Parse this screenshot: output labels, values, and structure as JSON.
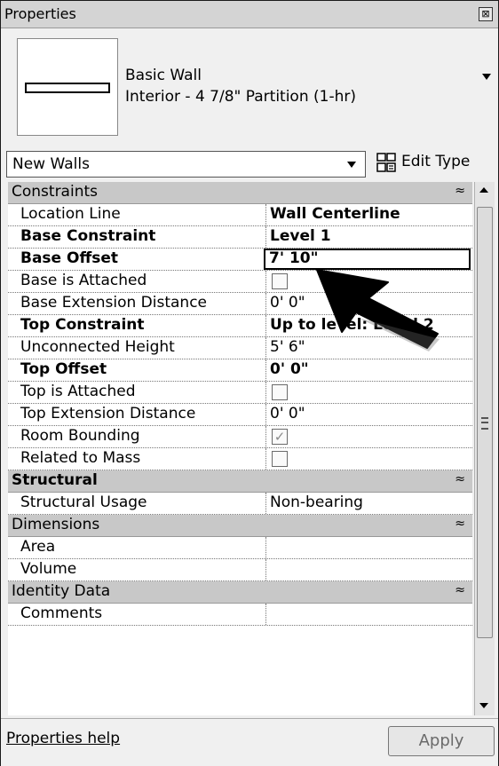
{
  "window": {
    "title": "Properties",
    "close_glyph": "⊠"
  },
  "type_selector": {
    "family": "Basic Wall",
    "type": "Interior - 4 7/8\" Partition (1-hr)"
  },
  "filter": {
    "value": "New Walls"
  },
  "edit_type": {
    "label": "Edit Type"
  },
  "groups": {
    "constraints": "Constraints",
    "structural": "Structural",
    "dimensions": "Dimensions",
    "identity": "Identity Data"
  },
  "chevron": "≈",
  "rows": {
    "location_line": {
      "name": "Location Line",
      "value": "Wall Centerline"
    },
    "base_constraint": {
      "name": "Base Constraint",
      "value": "Level 1"
    },
    "base_offset": {
      "name": "Base Offset",
      "value": "7' 10\""
    },
    "base_attached": {
      "name": "Base is Attached",
      "checked": false
    },
    "base_extension": {
      "name": "Base Extension Distance",
      "value": "0' 0\""
    },
    "top_constraint": {
      "name": "Top Constraint",
      "value": "Up to level: Level 2"
    },
    "unconnected_height": {
      "name": "Unconnected Height",
      "value": "5' 6\""
    },
    "top_offset": {
      "name": "Top Offset",
      "value": "0' 0\""
    },
    "top_attached": {
      "name": "Top is Attached",
      "checked": false
    },
    "top_extension": {
      "name": "Top Extension Distance",
      "value": "0' 0\""
    },
    "room_bounding": {
      "name": "Room Bounding",
      "checked": true,
      "check_glyph": "✓"
    },
    "related_mass": {
      "name": "Related to Mass",
      "checked": false
    },
    "structural_usage": {
      "name": "Structural Usage",
      "value": "Non-bearing"
    },
    "area": {
      "name": "Area",
      "value": ""
    },
    "volume": {
      "name": "Volume",
      "value": ""
    },
    "comments": {
      "name": "Comments",
      "value": ""
    }
  },
  "footer": {
    "help_label": "Properties help",
    "apply_label": "Apply"
  }
}
